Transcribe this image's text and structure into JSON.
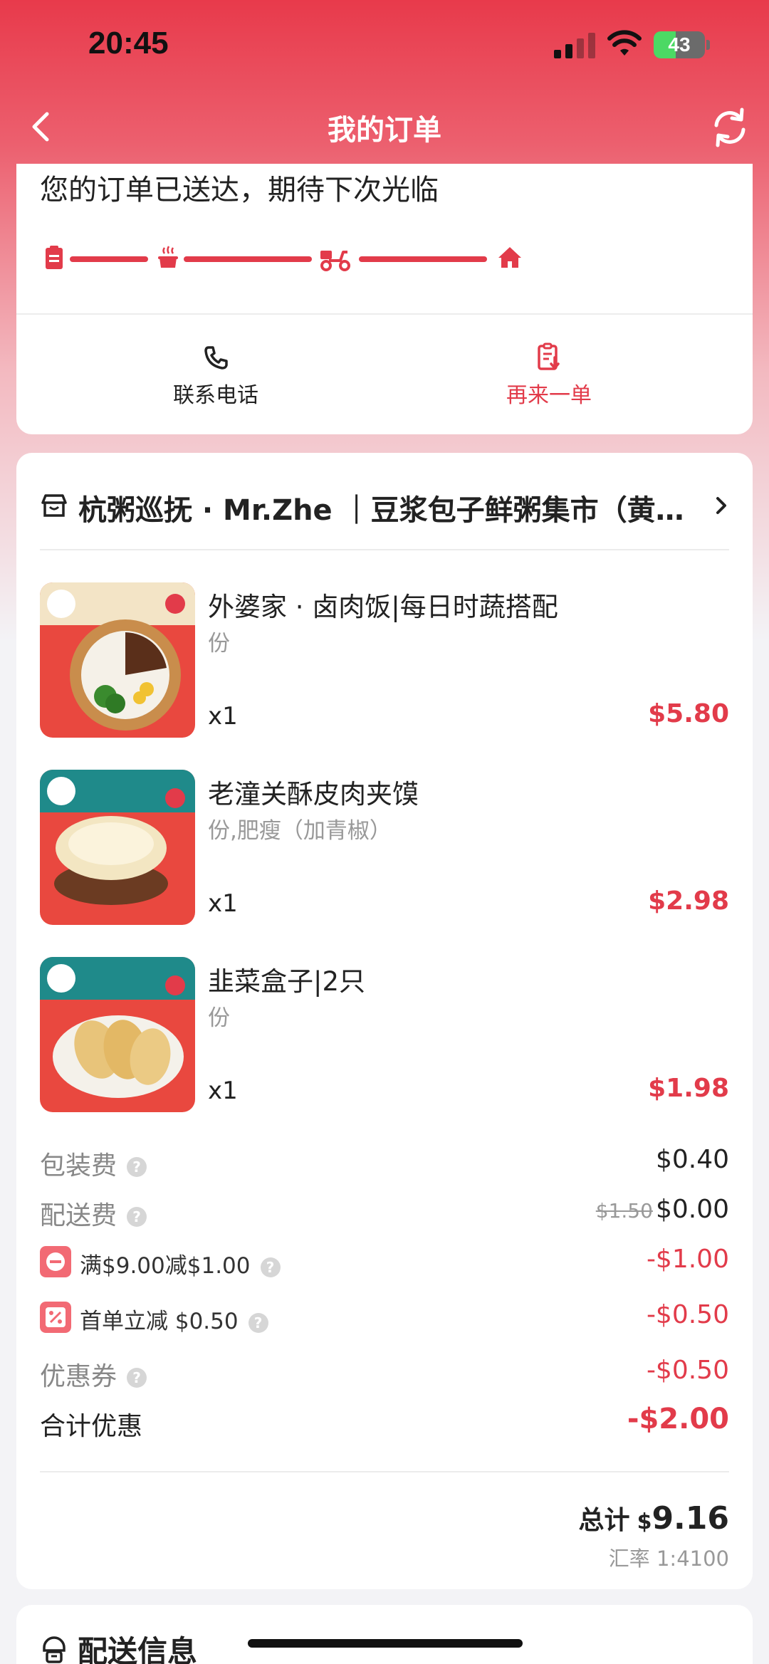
{
  "status_bar": {
    "time": "20:45",
    "battery_pct": "43",
    "battery_level": 0.43
  },
  "nav": {
    "title": "我的订单"
  },
  "order_status": {
    "message": "您的订单已送达，期待下次光临",
    "steps": [
      "placed-icon",
      "cooking-icon",
      "delivery-scooter-icon",
      "home-icon"
    ],
    "actions": {
      "contact": "联系电话",
      "reorder": "再来一单"
    }
  },
  "store": {
    "name": "杭粥巡抚 · Mr.Zhe ｜豆浆包子鲜粥集市（黄花园店）"
  },
  "items": [
    {
      "name": "外婆家 · 卤肉饭|每日时蔬搭配",
      "spec": "份",
      "qty": "x1",
      "price": "$5.80"
    },
    {
      "name": "老潼关酥皮肉夹馍",
      "spec": "份,肥瘦（加青椒）",
      "qty": "x1",
      "price": "$2.98"
    },
    {
      "name": "韭菜盒子|2只",
      "spec": "份",
      "qty": "x1",
      "price": "$1.98"
    }
  ],
  "fees": {
    "packaging": {
      "label": "包装费",
      "value": "$0.40"
    },
    "delivery": {
      "label": "配送费",
      "original": "$1.50",
      "value": "$0.00"
    },
    "full_reduction": {
      "label": "满$9.00减$1.00",
      "value": "-$1.00"
    },
    "first_order": {
      "label": "首单立减 $0.50",
      "value": "-$0.50"
    },
    "coupon": {
      "label": "优惠券",
      "value": "-$0.50"
    },
    "total_discount": {
      "label": "合计优惠",
      "value": "-$2.00"
    }
  },
  "total": {
    "label": "总计",
    "currency": "$",
    "amount": "9.16",
    "exchange_rate": "汇率 1:4100"
  },
  "delivery_section": {
    "title": "配送信息"
  },
  "help_mark": "?",
  "colors": {
    "accent": "#e23b4a",
    "header": "#e83a4b"
  }
}
